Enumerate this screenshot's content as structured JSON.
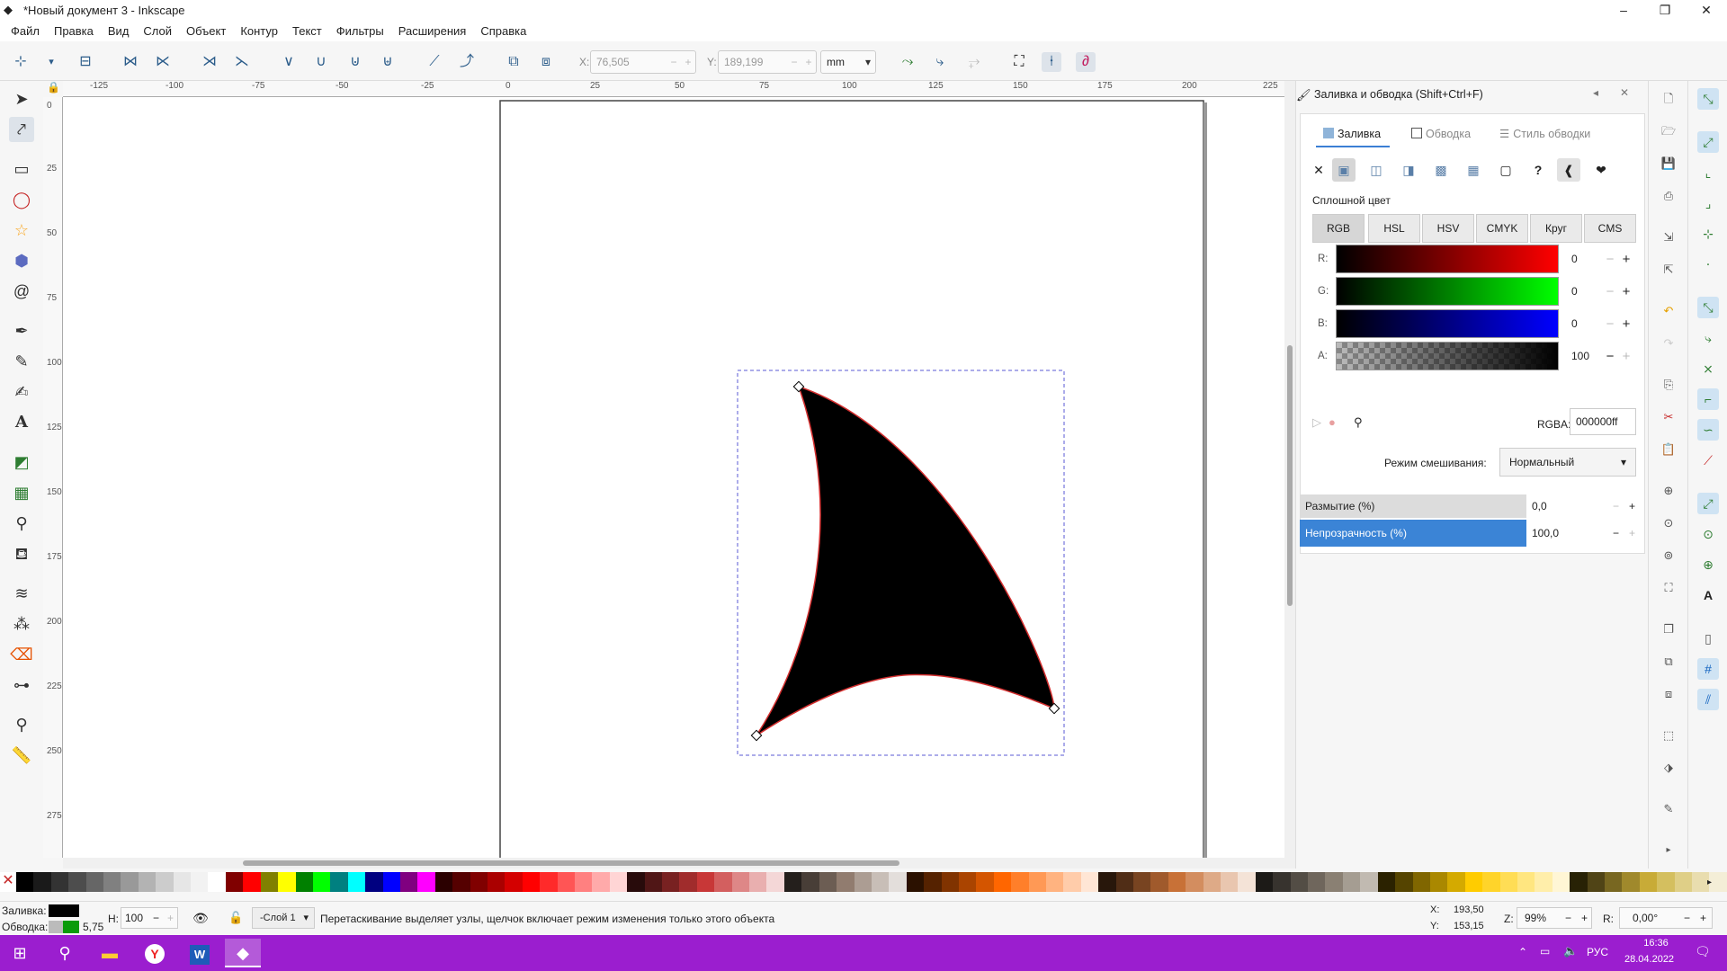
{
  "window": {
    "title": "*Новый документ 3 - Inkscape",
    "controls": [
      "–",
      "❐",
      "✕"
    ]
  },
  "menu": [
    "Файл",
    "Правка",
    "Вид",
    "Слой",
    "Объект",
    "Контур",
    "Текст",
    "Фильтры",
    "Расширения",
    "Справка"
  ],
  "toolbar": {
    "x_label": "X:",
    "x_value": "76,505",
    "y_label": "Y:",
    "y_value": "189,199",
    "unit": "mm"
  },
  "rulers": {
    "top_ticks": [
      "-125",
      "-100",
      "-75",
      "-50",
      "-25",
      "0",
      "25",
      "50",
      "75",
      "100",
      "125",
      "150",
      "175",
      "200",
      "225"
    ],
    "left_ticks": [
      "0",
      "25",
      "50",
      "75",
      "100",
      "125",
      "150",
      "175",
      "200",
      "225",
      "250",
      "275"
    ]
  },
  "fill_stroke": {
    "title": "Заливка и обводка (Shift+Ctrl+F)",
    "tabs": [
      "Заливка",
      "Обводка",
      "Стиль обводки"
    ],
    "paint_types": [
      "✕",
      "▣",
      "◫",
      "◨",
      "▩",
      "▦",
      "▢",
      "?",
      "❰",
      "❤"
    ],
    "section_label": "Сплошной цвет",
    "modes": [
      "RGB",
      "HSL",
      "HSV",
      "CMYK",
      "Круг",
      "CMS"
    ],
    "channels": [
      {
        "label": "R:",
        "value": "0"
      },
      {
        "label": "G:",
        "value": "0"
      },
      {
        "label": "B:",
        "value": "0"
      },
      {
        "label": "A:",
        "value": "100"
      }
    ],
    "rgba_label": "RGBA:",
    "rgba_value": "000000ff",
    "blend_label": "Режим смешивания:",
    "blend_value": "Нормальный",
    "blur_label": "Размытие (%)",
    "blur_value": "0,0",
    "opacity_label": "Непрозрачность (%)",
    "opacity_value": "100,0"
  },
  "status": {
    "fill_label": "Заливка:",
    "stroke_label": "Обводка:",
    "stroke_width": "5,75",
    "h_label": "H:",
    "h_value": "100",
    "layer": "-Слой 1",
    "message": "Перетаскивание выделяет узлы, щелчок включает режим изменения только этого объекта",
    "x_label": "X:",
    "x_value": "193,50",
    "y_label": "Y:",
    "y_value": "153,15",
    "zoom_label": "Z:",
    "zoom_value": "99%",
    "rotation_label": "R:",
    "rotation_value": "0,00°"
  },
  "taskbar": {
    "lang": "РУС",
    "time": "16:36",
    "date": "28.04.2022"
  },
  "palette": [
    "#000000",
    "#1a1a1a",
    "#333333",
    "#4d4d4d",
    "#666666",
    "#808080",
    "#999999",
    "#b3b3b3",
    "#cccccc",
    "#e6e6e6",
    "#f2f2f2",
    "#ffffff",
    "#800000",
    "#ff0000",
    "#808000",
    "#ffff00",
    "#008000",
    "#00ff00",
    "#008080",
    "#00ffff",
    "#000080",
    "#0000ff",
    "#800080",
    "#ff00ff",
    "#2b0000",
    "#550000",
    "#800000",
    "#aa0000",
    "#d40000",
    "#ff0000",
    "#ff2a2a",
    "#ff5555",
    "#ff8080",
    "#ffaaaa",
    "#ffd5d5",
    "#280b0b",
    "#501616",
    "#782121",
    "#a02c2c",
    "#c83737",
    "#d35f5f",
    "#de8787",
    "#e9afaf",
    "#f4d7d7",
    "#241f1c",
    "#483e37",
    "#6c5d53",
    "#917c6f",
    "#ac9d93",
    "#c8beb7",
    "#e3dedb",
    "#2b1100",
    "#552200",
    "#803300",
    "#aa4400",
    "#d45500",
    "#ff6600",
    "#ff7f2a",
    "#ff9955",
    "#ffb380",
    "#ffccaa",
    "#ffe6d5",
    "#28170b",
    "#502d16",
    "#784421",
    "#a05a2c",
    "#c87137",
    "#d38d5f",
    "#deaa87",
    "#e9c6af",
    "#f4e3d7",
    "#1c1a17",
    "#37332e",
    "#534d45",
    "#6f665c",
    "#8a8073",
    "#a59d92",
    "#c1bab1",
    "#2b2200",
    "#554400",
    "#806600",
    "#aa8800",
    "#d4aa00",
    "#ffcc00",
    "#ffd42a",
    "#ffdd55",
    "#ffe680",
    "#ffeeaa",
    "#fff6d5",
    "#282205",
    "#504416",
    "#786721",
    "#a0892c",
    "#c8ab37",
    "#d4bf5f",
    "#dfcf87",
    "#e9ddaf",
    "#f4eed7"
  ]
}
